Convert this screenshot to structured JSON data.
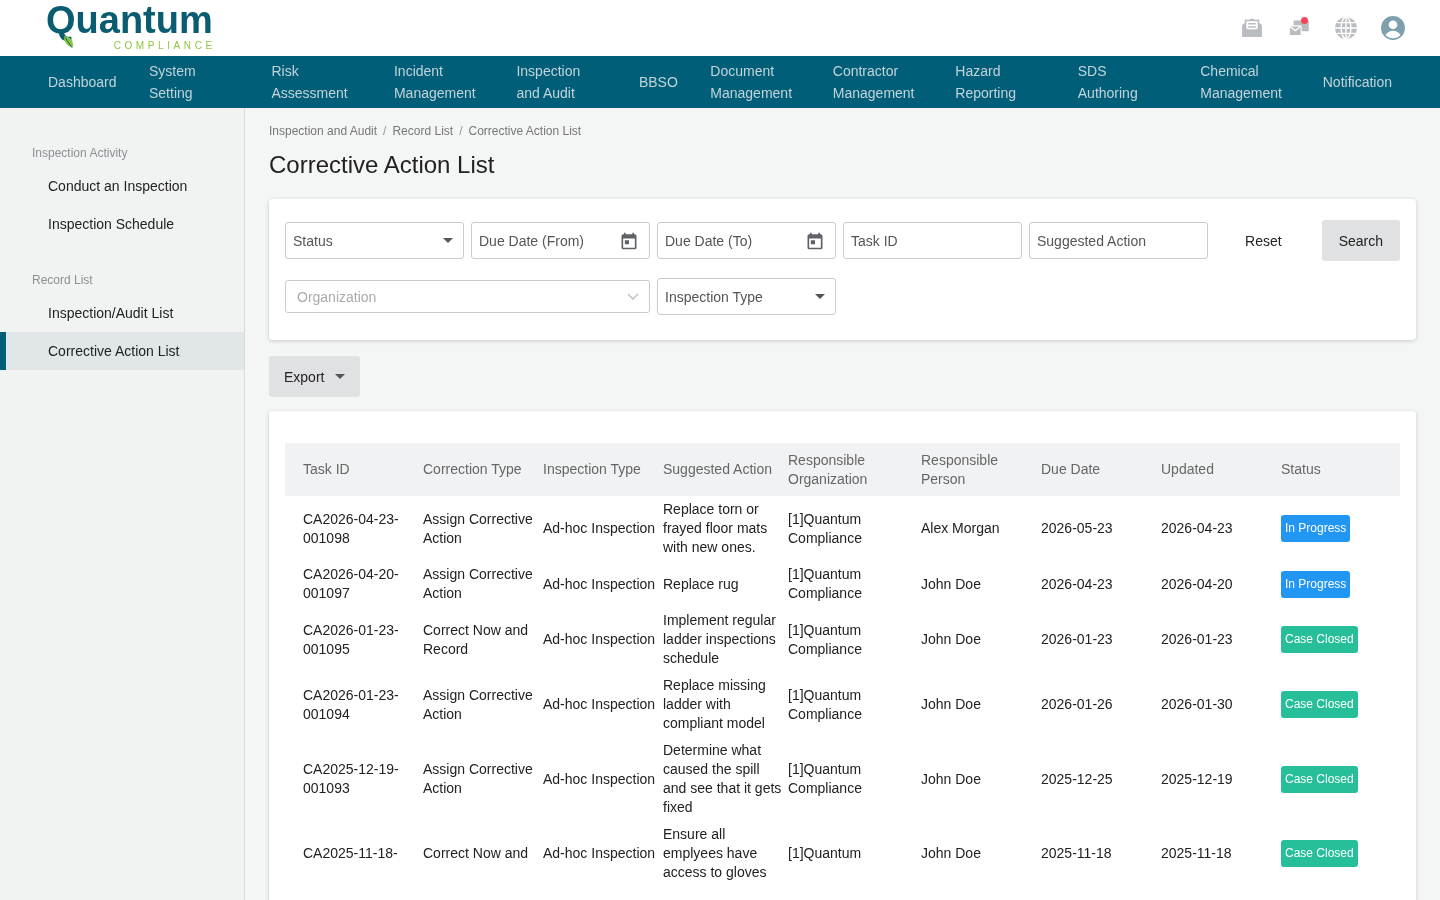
{
  "logo": {
    "name": "Quantum",
    "tagline": "COMPLIANCE"
  },
  "header_icons": [
    {
      "kind": "mail-open"
    },
    {
      "kind": "mail-stack",
      "badge": true
    },
    {
      "kind": "globe"
    },
    {
      "kind": "user"
    }
  ],
  "nav": [
    {
      "label": "Dashboard"
    },
    {
      "label": "System Setting"
    },
    {
      "label": "Risk Assessment"
    },
    {
      "label": "Incident Management"
    },
    {
      "label": "Inspection and Audit"
    },
    {
      "label": "BBSO"
    },
    {
      "label": "Document Management"
    },
    {
      "label": "Contractor Management"
    },
    {
      "label": "Hazard Reporting"
    },
    {
      "label": "SDS Authoring"
    },
    {
      "label": "Chemical Management"
    },
    {
      "label": "Notification"
    }
  ],
  "sidebar": {
    "sections": [
      {
        "title": "Inspection Activity",
        "items": [
          {
            "label": "Conduct an Inspection",
            "selected": false
          },
          {
            "label": "Inspection Schedule",
            "selected": false
          }
        ]
      },
      {
        "title": "Record List",
        "items": [
          {
            "label": "Inspection/Audit List",
            "selected": false
          },
          {
            "label": "Corrective Action List",
            "selected": true
          }
        ]
      }
    ]
  },
  "breadcrumb": [
    "Inspection and Audit",
    "Record List",
    "Corrective Action List"
  ],
  "breadcrumb_separator": "/",
  "page_title": "Corrective Action List",
  "filters": {
    "fields": [
      {
        "kind": "select",
        "placeholder": "Status",
        "disabled": false
      },
      {
        "kind": "date",
        "placeholder": "Due Date (From)",
        "disabled": false
      },
      {
        "kind": "date",
        "placeholder": "Due Date (To)",
        "disabled": false
      },
      {
        "kind": "text",
        "placeholder": "Task ID",
        "disabled": false
      },
      {
        "kind": "text",
        "placeholder": "Suggested Action",
        "disabled": false
      },
      {
        "kind": "select-wide",
        "placeholder": "Organization",
        "disabled": true
      },
      {
        "kind": "select",
        "placeholder": "Inspection Type",
        "disabled": false
      }
    ],
    "reset": "Reset",
    "search": "Search"
  },
  "export": "Export",
  "table": {
    "columns": [
      "Task ID",
      "Correction Type",
      "Inspection Type",
      "Suggested Action",
      "Responsible Organization",
      "Responsible Person",
      "Due Date",
      "Updated",
      "Status"
    ],
    "rows": [
      {
        "cells": [
          "CA2026-04-23-001098",
          "Assign Corrective Action",
          "Ad-hoc Inspection",
          "Replace torn or frayed floor mats with new ones.",
          "[1]Quantum Compliance",
          "Alex Morgan",
          "2026-05-23",
          "2026-04-23"
        ],
        "status": {
          "label": "In Progress",
          "color": "#2196f3"
        }
      },
      {
        "cells": [
          "CA2026-04-20-001097",
          "Assign Corrective Action",
          "Ad-hoc Inspection",
          "Replace rug",
          "[1]Quantum Compliance",
          "John Doe",
          "2026-04-23",
          "2026-04-20"
        ],
        "status": {
          "label": "In Progress",
          "color": "#2196f3"
        }
      },
      {
        "cells": [
          "CA2026-01-23-001095",
          "Correct Now and Record",
          "Ad-hoc Inspection",
          "Implement regular ladder inspections schedule",
          "[1]Quantum Compliance",
          "John Doe",
          "2026-01-23",
          "2026-01-23"
        ],
        "status": {
          "label": "Case Closed",
          "color": "#26bf9a"
        }
      },
      {
        "cells": [
          "CA2026-01-23-001094",
          "Assign Corrective Action",
          "Ad-hoc Inspection",
          "Replace missing ladder with compliant model",
          "[1]Quantum Compliance",
          "John Doe",
          "2026-01-26",
          "2026-01-30"
        ],
        "status": {
          "label": "Case Closed",
          "color": "#26bf9a"
        }
      },
      {
        "cells": [
          "CA2025-12-19-001093",
          "Assign Corrective Action",
          "Ad-hoc Inspection",
          "Determine what caused the spill and see that it gets fixed",
          "[1]Quantum Compliance",
          "John Doe",
          "2025-12-25",
          "2025-12-19"
        ],
        "status": {
          "label": "Case Closed",
          "color": "#26bf9a"
        }
      },
      {
        "cells": [
          "CA2025-11-18-",
          "Correct Now and",
          "Ad-hoc Inspection",
          "Ensure all emplyees have access to gloves",
          "[1]Quantum",
          "John Doe",
          "2025-11-18",
          "2025-11-18"
        ],
        "status": {
          "label": "Case Closed",
          "color": "#26bf9a"
        }
      }
    ]
  }
}
